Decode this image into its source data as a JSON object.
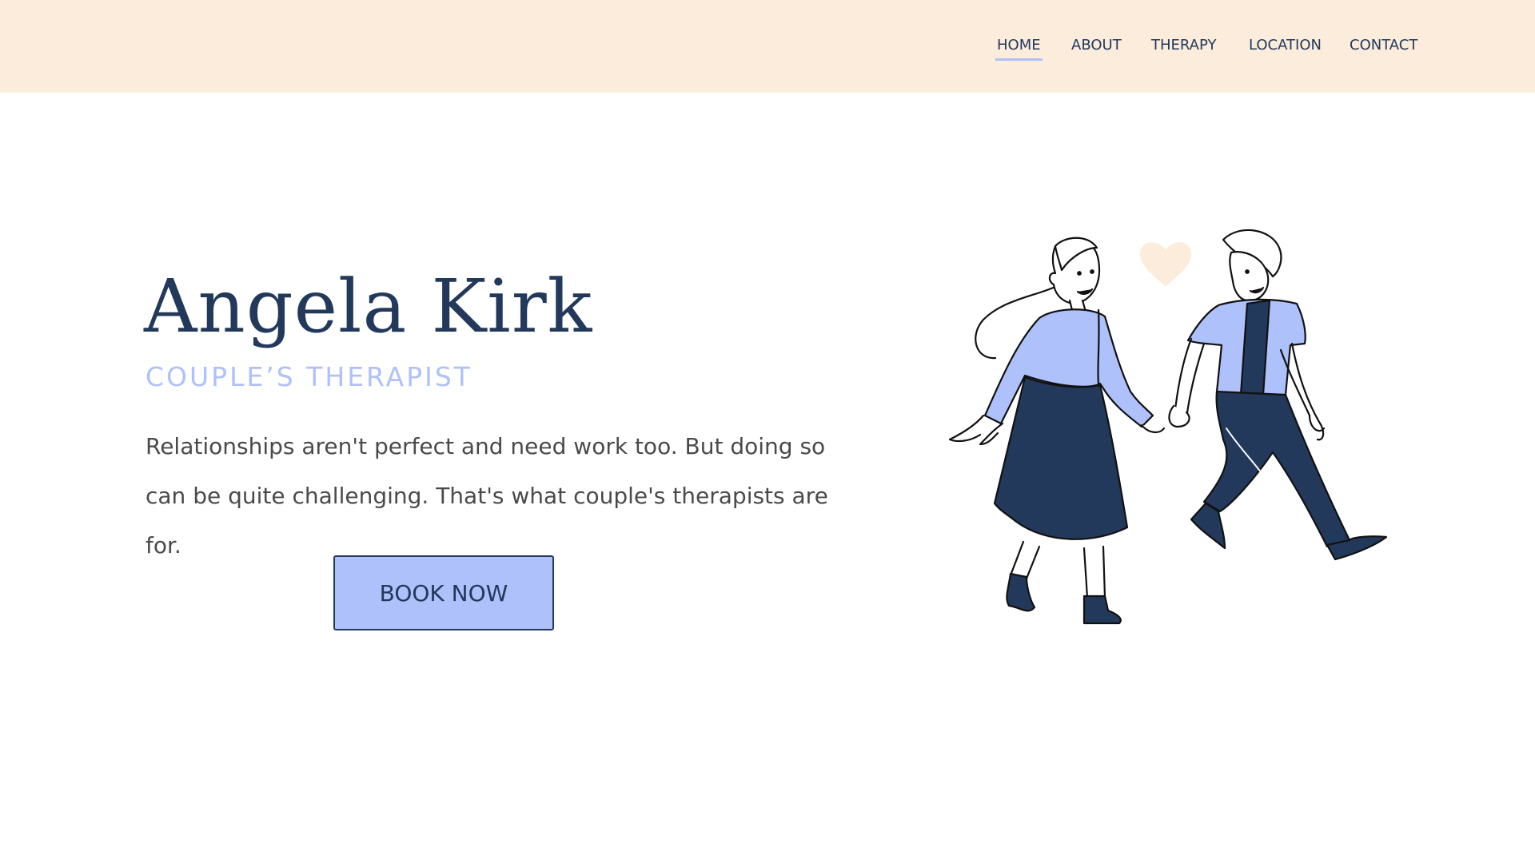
{
  "nav": {
    "items": [
      {
        "label": "HOME",
        "active": true
      },
      {
        "label": "ABOUT",
        "active": false
      },
      {
        "label": "THERAPY",
        "active": false
      },
      {
        "label": "LOCATION",
        "active": false
      },
      {
        "label": "CONTACT",
        "active": false
      }
    ]
  },
  "hero": {
    "title": "Angela Kirk",
    "subtitle": "COUPLE’S THERAPIST",
    "description": "Relationships aren't perfect and need work too. But doing so can be quite challenging. That's what couple's therapists are for.",
    "cta_label": "BOOK NOW"
  },
  "illustration": {
    "subject": "couple-holding-hands-walking",
    "icon": "heart-icon"
  },
  "colors": {
    "header_bg": "#fcecdc",
    "navy": "#23395b",
    "periwinkle": "#aec1fb",
    "body_text": "#4a4a4a"
  }
}
